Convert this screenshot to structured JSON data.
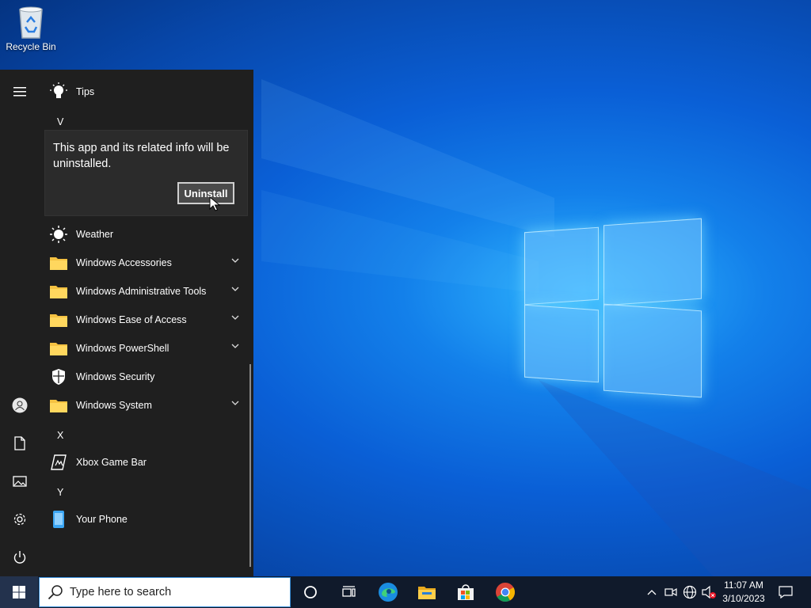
{
  "desktop": {
    "icons": [
      {
        "label": "Recycle Bin",
        "icon": "recycle-bin-icon"
      }
    ]
  },
  "start_menu": {
    "rail": [
      "hamburger-icon",
      "user-icon",
      "documents-icon",
      "pictures-icon",
      "settings-icon",
      "power-icon"
    ],
    "top_item": {
      "label": "Tips",
      "icon": "lightbulb-icon"
    },
    "letters": {
      "v": "V",
      "x": "X",
      "y": "Y"
    },
    "uninstall_dialog": {
      "message": "This app and its related info will be uninstalled.",
      "button": "Uninstall"
    },
    "items": [
      {
        "label": "Weather",
        "icon": "sun-icon",
        "expandable": false
      },
      {
        "label": "Windows Accessories",
        "icon": "folder-icon",
        "expandable": true
      },
      {
        "label": "Windows Administrative Tools",
        "icon": "folder-icon",
        "expandable": true
      },
      {
        "label": "Windows Ease of Access",
        "icon": "folder-icon",
        "expandable": true
      },
      {
        "label": "Windows PowerShell",
        "icon": "folder-icon",
        "expandable": true
      },
      {
        "label": "Windows Security",
        "icon": "shield-icon",
        "expandable": false
      },
      {
        "label": "Windows System",
        "icon": "folder-icon",
        "expandable": true
      },
      {
        "label": "Xbox Game Bar",
        "icon": "xbox-game-bar-icon",
        "expandable": false
      },
      {
        "label": "Your Phone",
        "icon": "phone-icon",
        "expandable": false
      }
    ]
  },
  "taskbar": {
    "search_placeholder": "Type here to search",
    "pinned": [
      "cortana-icon",
      "task-view-icon",
      "edge-icon",
      "file-explorer-icon",
      "store-icon",
      "chrome-icon"
    ],
    "tray": [
      "chevron-up-icon",
      "meet-now-icon",
      "network-icon",
      "volume-muted-icon"
    ],
    "clock": {
      "time": "11:07 AM",
      "date": "3/10/2023"
    },
    "notification": "action-center-icon"
  },
  "colors": {
    "start_bg": "#1f1f1f",
    "taskbar_bg": "#101a2b",
    "folder": "#f5c242",
    "desktop_accent": "#1380ea"
  }
}
